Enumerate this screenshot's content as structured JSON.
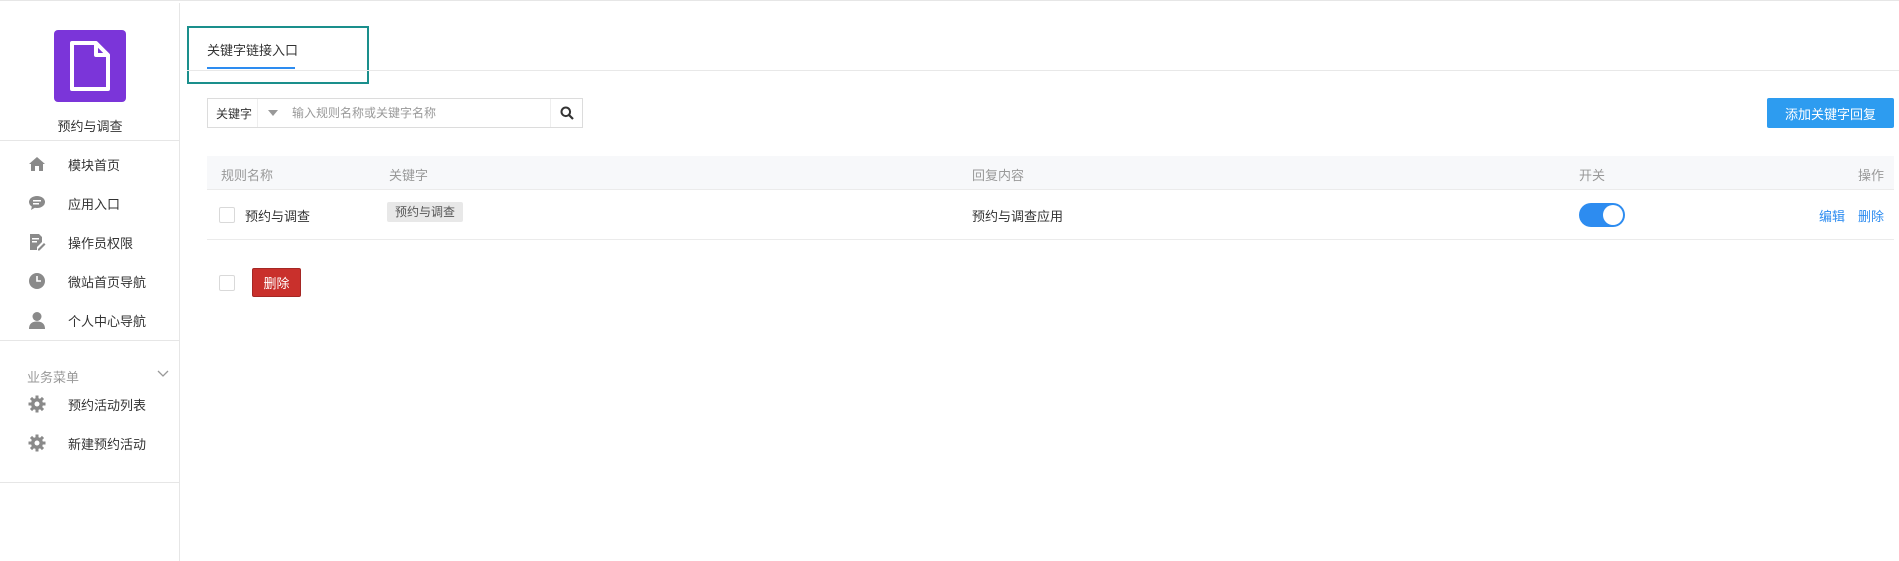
{
  "sidebar": {
    "module_name": "预约与调查",
    "items": [
      {
        "label": "模块首页",
        "icon": "home-icon"
      },
      {
        "label": "应用入口",
        "icon": "chat-bubble-icon"
      },
      {
        "label": "操作员权限",
        "icon": "document-edit-icon"
      },
      {
        "label": "微站首页导航",
        "icon": "compass-icon"
      },
      {
        "label": "个人中心导航",
        "icon": "user-icon"
      }
    ],
    "section_title": "业务菜单",
    "section_items": [
      {
        "label": "预约活动列表",
        "icon": "gear-icon"
      },
      {
        "label": "新建预约活动",
        "icon": "gear-icon"
      }
    ]
  },
  "tabs": [
    {
      "label": "关键字链接入口",
      "active": true
    }
  ],
  "search": {
    "filter_value": "关键字",
    "placeholder": "输入规则名称或关键字名称"
  },
  "toolbar": {
    "add_label": "添加关键字回复"
  },
  "table": {
    "columns": [
      "规则名称",
      "关键字",
      "回复内容",
      "开关",
      "操作"
    ],
    "rows": [
      {
        "rule_name": "预约与调查",
        "keyword": "预约与调查",
        "reply": "预约与调查应用",
        "enabled": true,
        "edit_label": "编辑",
        "delete_label": "删除"
      }
    ]
  },
  "footer": {
    "delete_label": "删除"
  },
  "colors": {
    "accent": "#2d8cf0",
    "logo": "#7b35d9",
    "danger": "#c9302c",
    "tab_highlight": "#1a8f8c"
  }
}
